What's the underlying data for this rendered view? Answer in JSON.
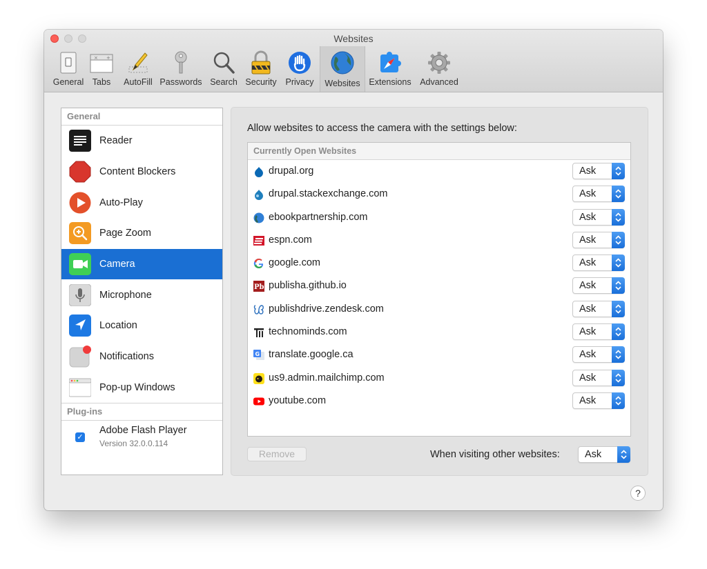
{
  "window": {
    "title": "Websites"
  },
  "toolbar": {
    "items": [
      {
        "label": "General",
        "icon": "general-switch-icon"
      },
      {
        "label": "Tabs",
        "icon": "tabs-icon"
      },
      {
        "label": "AutoFill",
        "icon": "autofill-pencil-icon"
      },
      {
        "label": "Passwords",
        "icon": "key-icon"
      },
      {
        "label": "Search",
        "icon": "magnifier-icon"
      },
      {
        "label": "Security",
        "icon": "padlock-icon"
      },
      {
        "label": "Privacy",
        "icon": "hand-icon"
      },
      {
        "label": "Websites",
        "icon": "globe-icon",
        "selected": true
      },
      {
        "label": "Extensions",
        "icon": "puzzle-compass-icon"
      },
      {
        "label": "Advanced",
        "icon": "gear-icon"
      }
    ]
  },
  "sidebar": {
    "general_header": "General",
    "items": [
      {
        "label": "Reader",
        "icon": "reader-icon"
      },
      {
        "label": "Content Blockers",
        "icon": "stop-sign-icon"
      },
      {
        "label": "Auto-Play",
        "icon": "play-icon"
      },
      {
        "label": "Page Zoom",
        "icon": "zoom-icon"
      },
      {
        "label": "Camera",
        "icon": "camera-icon",
        "selected": true
      },
      {
        "label": "Microphone",
        "icon": "microphone-icon"
      },
      {
        "label": "Location",
        "icon": "location-arrow-icon"
      },
      {
        "label": "Notifications",
        "icon": "notifications-icon"
      },
      {
        "label": "Pop-up Windows",
        "icon": "popup-windows-icon"
      }
    ],
    "plugins_header": "Plug-ins",
    "plugins": [
      {
        "name": "Adobe Flash Player",
        "version": "Version 32.0.0.114",
        "checked": true
      }
    ]
  },
  "main": {
    "description": "Allow websites to access the camera with the settings below:",
    "list_header": "Currently Open Websites",
    "sites": [
      {
        "domain": "drupal.org",
        "setting": "Ask",
        "icon": "drupal-favicon"
      },
      {
        "domain": "drupal.stackexchange.com",
        "setting": "Ask",
        "icon": "drupal-drop-favicon"
      },
      {
        "domain": "ebookpartnership.com",
        "setting": "Ask",
        "icon": "globe-favicon"
      },
      {
        "domain": "espn.com",
        "setting": "Ask",
        "icon": "espn-favicon"
      },
      {
        "domain": "google.com",
        "setting": "Ask",
        "icon": "google-favicon"
      },
      {
        "domain": "publisha.github.io",
        "setting": "Ask",
        "icon": "publisha-favicon"
      },
      {
        "domain": "publishdrive.zendesk.com",
        "setting": "Ask",
        "icon": "publishdrive-favicon"
      },
      {
        "domain": "technominds.com",
        "setting": "Ask",
        "icon": "technominds-favicon"
      },
      {
        "domain": "translate.google.ca",
        "setting": "Ask",
        "icon": "google-translate-favicon"
      },
      {
        "domain": "us9.admin.mailchimp.com",
        "setting": "Ask",
        "icon": "mailchimp-favicon"
      },
      {
        "domain": "youtube.com",
        "setting": "Ask",
        "icon": "youtube-favicon"
      }
    ],
    "remove_label": "Remove",
    "other_websites_label": "When visiting other websites:",
    "other_websites_value": "Ask"
  },
  "help_label": "?",
  "colors": {
    "selection": "#1a6fd3",
    "popup_button": "#1f7ae6",
    "close": "#fc5f57"
  }
}
